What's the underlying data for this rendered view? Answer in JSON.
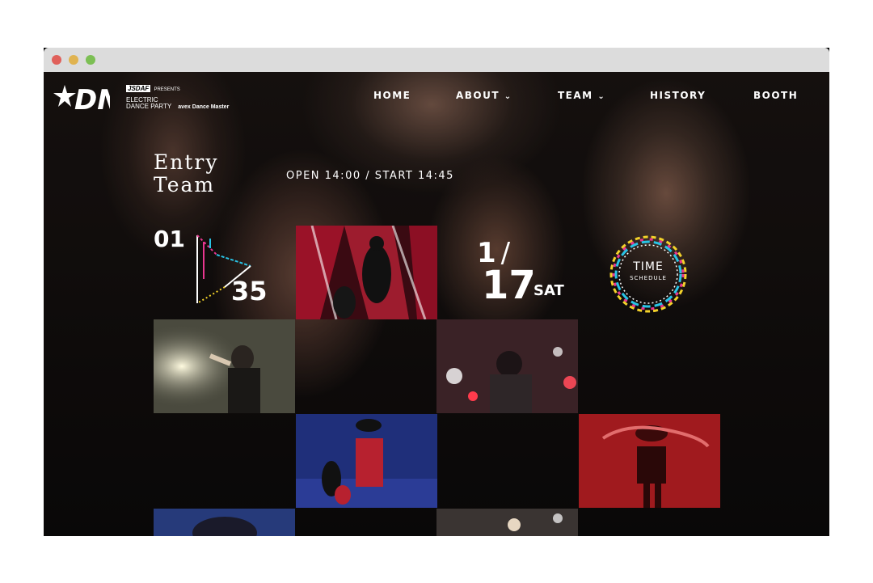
{
  "nav": {
    "items": [
      {
        "label": "HOME",
        "has_dropdown": false
      },
      {
        "label": "ABOUT",
        "has_dropdown": true
      },
      {
        "label": "TEAM",
        "has_dropdown": true
      },
      {
        "label": "HISTORY",
        "has_dropdown": false
      },
      {
        "label": "BOOTH",
        "has_dropdown": false
      }
    ],
    "dropdown_icon": "⌄"
  },
  "brand": {
    "logo_text": "DN",
    "sponsor_top": "JSDAF",
    "presents": "PRESENTS",
    "event_line1": "ELECTRIC",
    "event_line2": "DANCE PARTY",
    "partner": "avex Dance Master"
  },
  "hero": {
    "title_line1": "Entry",
    "title_line2": "Team",
    "times": "OPEN 14:00   /  START   14:45"
  },
  "counter": {
    "current": "01",
    "total": "35"
  },
  "event_date": {
    "month": "1",
    "slash": "/",
    "day": "17",
    "weekday": "SAT"
  },
  "schedule": {
    "title": "TIME",
    "subtitle": "SCHEDULE"
  },
  "colors": {
    "accent_pink": "#e8368f",
    "accent_cyan": "#29c3e5",
    "accent_yellow": "#f3d22a",
    "nav_text": "#ffffff"
  }
}
